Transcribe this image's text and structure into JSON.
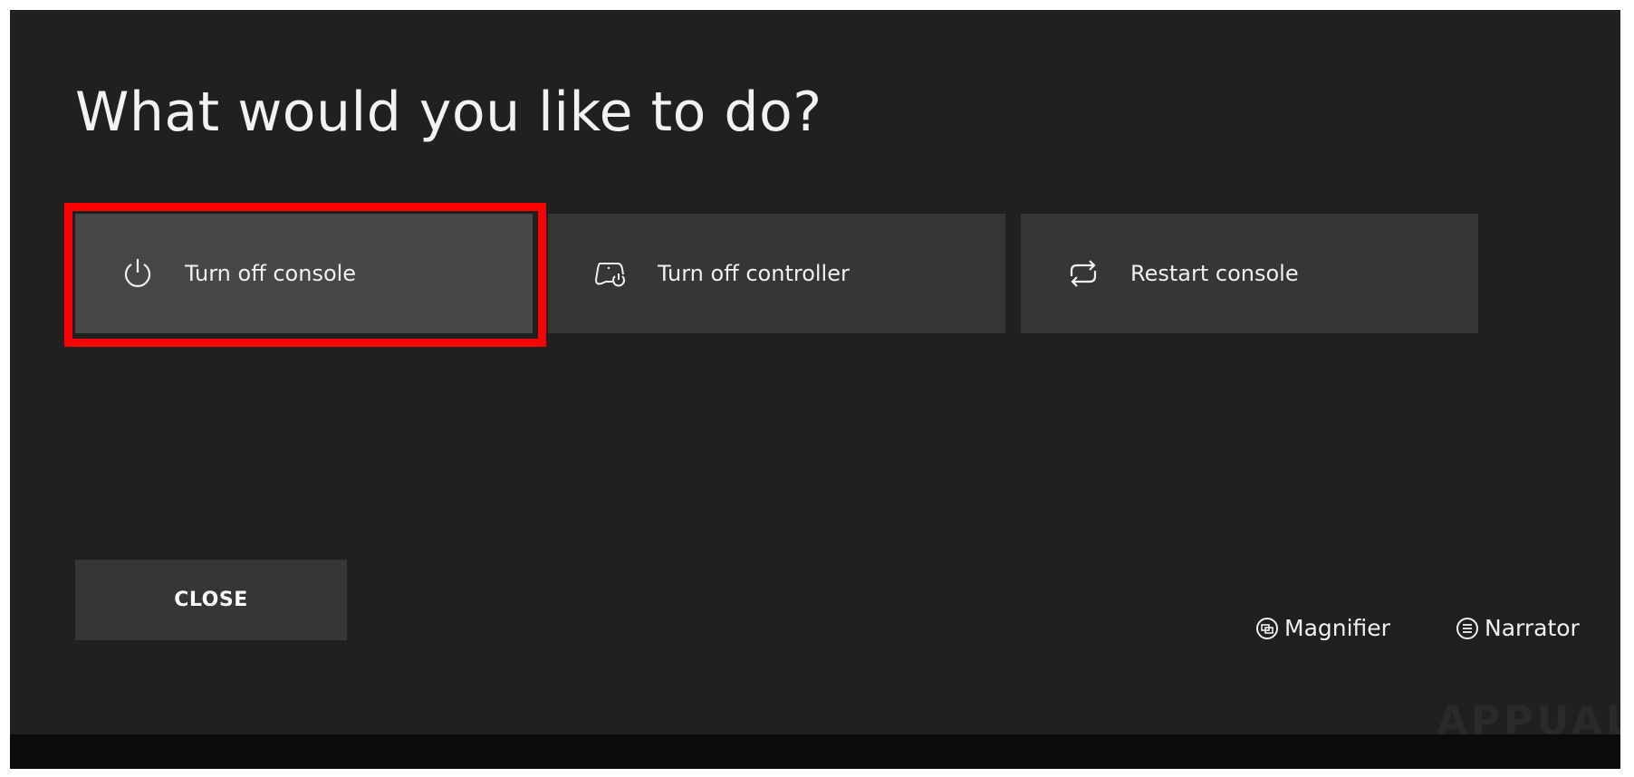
{
  "dialog": {
    "title": "What would you like to do?",
    "options": [
      {
        "label": "Turn off console",
        "icon": "power-icon",
        "selected": true
      },
      {
        "label": "Turn off controller",
        "icon": "controller-power-icon",
        "selected": false
      },
      {
        "label": "Restart console",
        "icon": "restart-icon",
        "selected": false
      }
    ],
    "close_label": "CLOSE"
  },
  "accessibility": {
    "magnifier_label": "Magnifier",
    "narrator_label": "Narrator"
  },
  "watermark": "APPUALS",
  "colors": {
    "highlight": "#ff0000",
    "background": "#202020",
    "tile": "#363636",
    "tile_selected": "#474747"
  }
}
